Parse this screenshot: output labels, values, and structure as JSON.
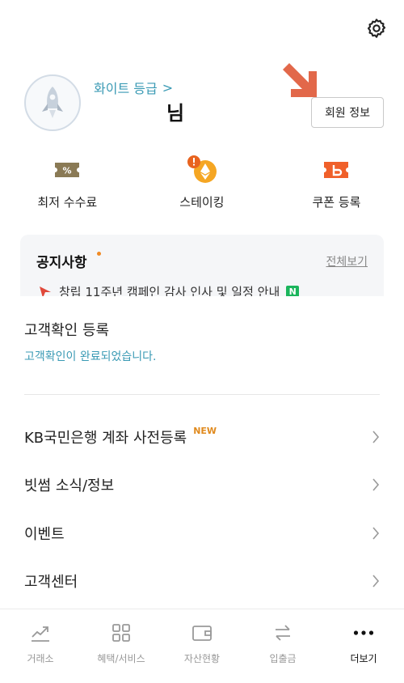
{
  "header": {
    "settings_icon": "gear-icon"
  },
  "profile": {
    "avatar_icon": "rocket-icon",
    "grade_label": "화이트 등급",
    "grade_chevron": ">",
    "nickname": "님",
    "member_info_button": "회원 정보"
  },
  "quick_actions": [
    {
      "label": "최저 수수료",
      "icon": "fee-ticket-icon",
      "color": "#8a7a55"
    },
    {
      "label": "스테이킹",
      "icon": "ethereum-coin-icon",
      "color": "#f5a623"
    },
    {
      "label": "쿠폰 등록",
      "icon": "coupon-icon",
      "color": "#f0602a"
    }
  ],
  "notice": {
    "title": "공지사항",
    "view_all": "전체보기",
    "ticker_text": "창립 11주년 캠페인 감사 인사 및 일정 안내",
    "new_badge": "N"
  },
  "verification": {
    "title": "고객확인 등록",
    "status": "고객확인이 완료되었습니다."
  },
  "menu": [
    {
      "label": "KB국민은행 계좌 사전등록",
      "badge": "NEW"
    },
    {
      "label": "빗썸 소식/정보",
      "badge": ""
    },
    {
      "label": "이벤트",
      "badge": ""
    },
    {
      "label": "고객센터",
      "badge": ""
    }
  ],
  "tabbar": [
    {
      "label": "거래소",
      "icon": "chart-trend-icon",
      "active": false
    },
    {
      "label": "혜택/서비스",
      "icon": "grid-icon",
      "active": false
    },
    {
      "label": "자산현황",
      "icon": "wallet-icon",
      "active": false
    },
    {
      "label": "입출금",
      "icon": "transfer-arrows-icon",
      "active": false
    },
    {
      "label": "더보기",
      "icon": "more-dots-icon",
      "active": true
    }
  ],
  "colors": {
    "accent": "#3a9ab4",
    "arrow": "#e2684a",
    "new_badge": "#e08a1e",
    "notice_dot": "#f08a24"
  }
}
